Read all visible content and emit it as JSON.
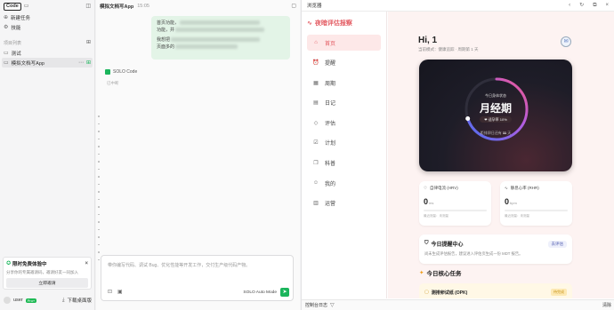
{
  "sidebar": {
    "code_label": "Code",
    "new_task": "新建任务",
    "skills": "技能",
    "projects_section": "项目列表",
    "projects": [
      {
        "name": "测试"
      },
      {
        "name": "模拟文档写App"
      }
    ],
    "promo": {
      "title": "限时免费体验中",
      "desc": "分享你的专属邀请码，邀请好友一同加入",
      "button": "立即邀请"
    },
    "user": {
      "name": "user",
      "badge": "Pro+",
      "download": "下载桌面版"
    }
  },
  "chat": {
    "title": "模拟文档写App",
    "time": "15:05",
    "bubble_lines": [
      "首页功能，",
      "功能，并",
      "我想把",
      "页面多的"
    ],
    "agent_label": "SOLO Code",
    "stopped_label": "已中断",
    "input_placeholder": "带你编写代码、调试 Bug、优化性能等开发工作，交付生产级代码产物。",
    "mode_label": "SOLO Auto Mode"
  },
  "browser": {
    "title": "浏览器",
    "footer_left": "控制台日志",
    "footer_right": "清除"
  },
  "app": {
    "brand": "夜暗评估报察",
    "nav": [
      {
        "label": "首页",
        "icon": "home-icon",
        "glyph": "⌂",
        "active": true
      },
      {
        "label": "提醒",
        "icon": "alarm-icon",
        "glyph": "⏰",
        "active": false
      },
      {
        "label": "周期",
        "icon": "calendar-icon",
        "glyph": "▦",
        "active": false
      },
      {
        "label": "日记",
        "icon": "diary-icon",
        "glyph": "▤",
        "active": false
      },
      {
        "label": "评估",
        "icon": "assessment-icon",
        "glyph": "◇",
        "active": false
      },
      {
        "label": "计划",
        "icon": "plan-icon",
        "glyph": "☑",
        "active": false
      },
      {
        "label": "科普",
        "icon": "book-icon",
        "glyph": "❐",
        "active": false
      },
      {
        "label": "我的",
        "icon": "user-icon",
        "glyph": "☺",
        "active": false
      },
      {
        "label": "运营",
        "icon": "admin-icon",
        "glyph": "▥",
        "active": false
      }
    ],
    "greeting": "Hi, 1",
    "greeting_sub": "当前模式：健康追踪 · 周期第 1 天",
    "hero": {
      "label": "今日身体状态",
      "phase": "月经期",
      "pill": "❤ 适孕率 10%",
      "foot_prefix": "距排卵日还有",
      "foot_days": "11",
      "foot_suffix": "天",
      "progress": 0.7
    },
    "hrv": {
      "title": "自律电流 (HRV)",
      "value": "0",
      "unit": "ms",
      "note": "最近测量：未测量"
    },
    "rhr": {
      "title": "静息心率 (RHR)",
      "value": "0",
      "unit": "bpm",
      "note": "最近测量：未测量"
    },
    "reminders": {
      "title": "今日提醒中心",
      "button": "去评估",
      "desc": "尚未生成评估报告，建议进入评估页生成一份 MDT 报告。"
    },
    "tasks_title": "今日核心任务",
    "task": {
      "title": "测排卵试纸 (OPK)",
      "tag": "待完成"
    }
  }
}
